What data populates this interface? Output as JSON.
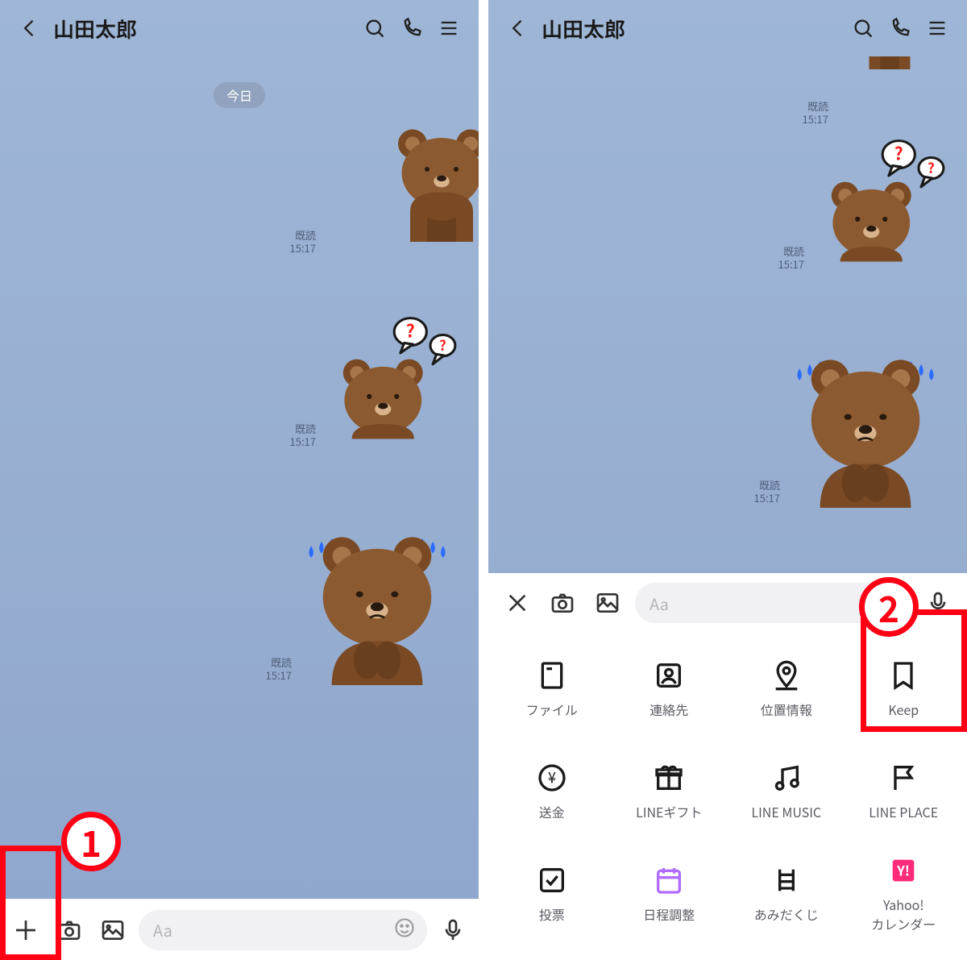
{
  "left": {
    "header": {
      "title": "山田太郎"
    },
    "date_badge": "今日",
    "messages": [
      {
        "read": "既読",
        "time": "15:17"
      },
      {
        "read": "既読",
        "time": "15:17"
      },
      {
        "read": "既読",
        "time": "15:17"
      }
    ],
    "input": {
      "placeholder": "Aa"
    },
    "callout": "1"
  },
  "right": {
    "header": {
      "title": "山田太郎"
    },
    "messages": [
      {
        "read": "既読",
        "time": "15:17"
      },
      {
        "read": "既読",
        "time": "15:17"
      },
      {
        "read": "既読",
        "time": "15:17"
      }
    ],
    "input": {
      "placeholder": "Aa"
    },
    "panel": {
      "items": [
        {
          "label": "ファイル"
        },
        {
          "label": "連絡先"
        },
        {
          "label": "位置情報"
        },
        {
          "label": "Keep"
        },
        {
          "label": "送金"
        },
        {
          "label": "LINEギフト"
        },
        {
          "label": "LINE MUSIC"
        },
        {
          "label": "LINE PLACE"
        },
        {
          "label": "投票"
        },
        {
          "label": "日程調整"
        },
        {
          "label": "あみだくじ"
        },
        {
          "label": "Yahoo!\nカレンダー"
        }
      ]
    },
    "callout": "2"
  }
}
